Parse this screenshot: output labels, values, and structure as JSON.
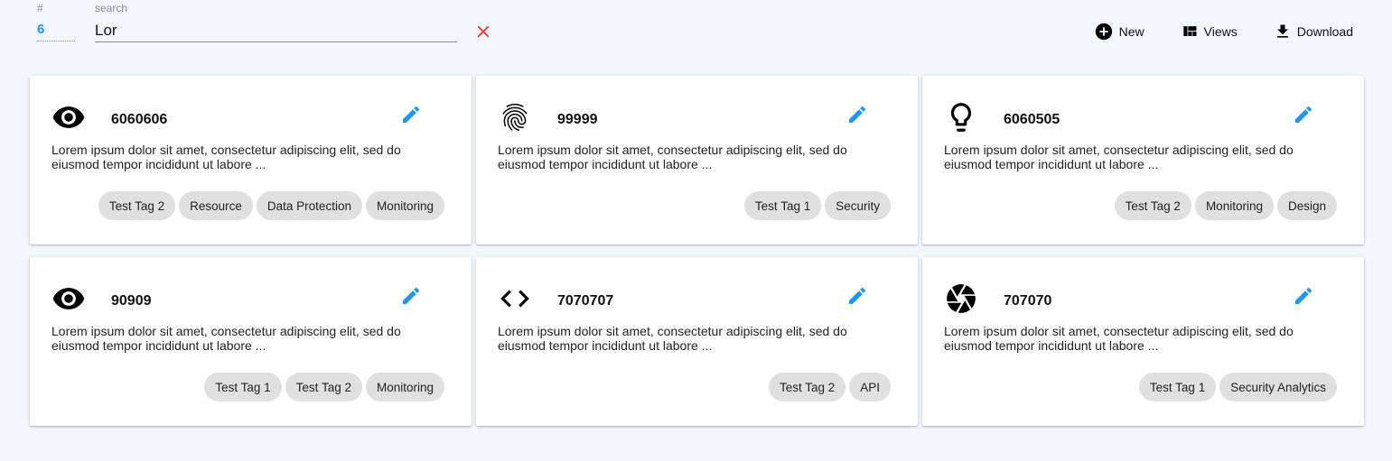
{
  "header": {
    "count_label": "#",
    "count_value": "6",
    "search_label": "search",
    "search_value": "Lor",
    "clear_icon": "close-icon",
    "actions": [
      {
        "label": "New",
        "icon": "add-circle-icon"
      },
      {
        "label": "Views",
        "icon": "view-quilt-icon"
      },
      {
        "label": "Download",
        "icon": "download-icon"
      }
    ]
  },
  "colors": {
    "accent": "#2196f3",
    "clear": "#e53935",
    "background": "#f2f7fc",
    "tag_bg": "#e0e0e0"
  },
  "cards": [
    {
      "icon": "eye-icon",
      "title": "6060606",
      "description": "Lorem ipsum dolor sit amet, consectetur adipiscing elit, sed do eiusmod tempor incididunt ut labore ...",
      "tags": [
        "Test Tag 2",
        "Resource",
        "Data Protection",
        "Monitoring"
      ]
    },
    {
      "icon": "fingerprint-icon",
      "title": "99999",
      "description": "Lorem ipsum dolor sit amet, consectetur adipiscing elit, sed do eiusmod tempor incididunt ut labore ...",
      "tags": [
        "Test Tag 1",
        "Security"
      ]
    },
    {
      "icon": "lightbulb-icon",
      "title": "6060505",
      "description": "Lorem ipsum dolor sit amet, consectetur adipiscing elit, sed do eiusmod tempor incididunt ut labore ...",
      "tags": [
        "Test Tag 2",
        "Monitoring",
        "Design"
      ]
    },
    {
      "icon": "eye-icon",
      "title": "90909",
      "description": "Lorem ipsum dolor sit amet, consectetur adipiscing elit, sed do eiusmod tempor incididunt ut labore ...",
      "tags": [
        "Test Tag 1",
        "Test Tag 2",
        "Monitoring"
      ]
    },
    {
      "icon": "code-icon",
      "title": "7070707",
      "description": "Lorem ipsum dolor sit amet, consectetur adipiscing elit, sed do eiusmod tempor incididunt ut labore ...",
      "tags": [
        "Test Tag 2",
        "API"
      ]
    },
    {
      "icon": "camera-shutter-icon",
      "title": "707070",
      "description": "Lorem ipsum dolor sit amet, consectetur adipiscing elit, sed do eiusmod tempor incididunt ut labore ...",
      "tags": [
        "Test Tag 1",
        "Security Analytics"
      ]
    }
  ]
}
